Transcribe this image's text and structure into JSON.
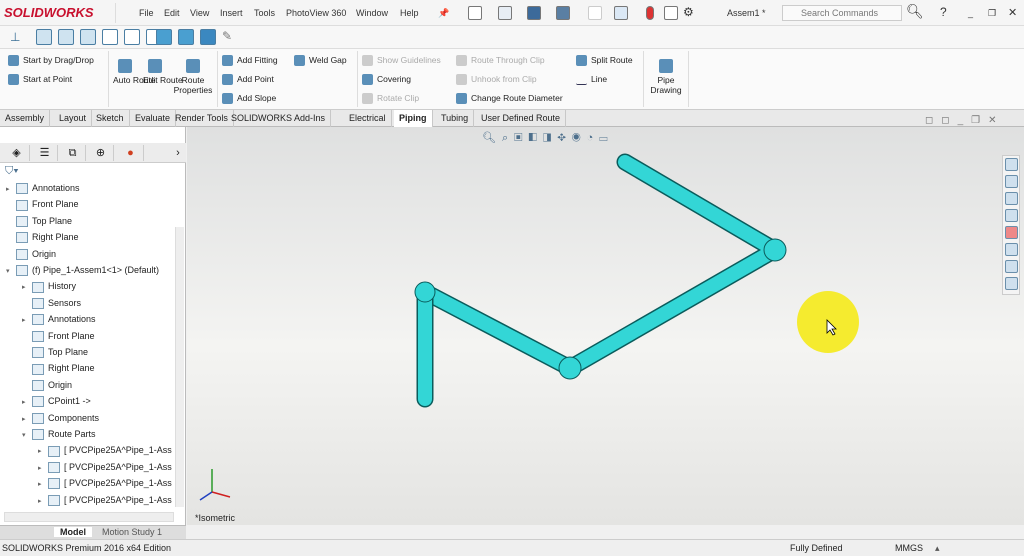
{
  "app": {
    "brand": "SOLIDWORKS",
    "document_title": "Assem1 *",
    "search_placeholder": "Search Commands"
  },
  "menu": [
    "File",
    "Edit",
    "View",
    "Insert",
    "Tools",
    "PhotoView 360",
    "Window",
    "Help"
  ],
  "ribbon": {
    "start_drag_drop": "Start by Drag/Drop",
    "start_at_point": "Start at Point",
    "auto_route": "Auto Route",
    "edit_route": "Edit Route",
    "route_properties": "Route Properties",
    "add_fitting": "Add Fitting",
    "add_point": "Add Point",
    "add_slope": "Add Slope",
    "weld_gap": "Weld Gap",
    "show_guidelines": "Show Guidelines",
    "covering": "Covering",
    "rotate_clip": "Rotate Clip",
    "route_through_clip": "Route Through Clip",
    "unhook_from_clip": "Unhook from Clip",
    "change_route_diameter": "Change Route Diameter",
    "split_route": "Split Route",
    "line": "Line",
    "pipe_drawing": "Pipe Drawing"
  },
  "tabs": [
    {
      "label": "Assembly"
    },
    {
      "label": "Layout"
    },
    {
      "label": "Sketch"
    },
    {
      "label": "Evaluate"
    },
    {
      "label": "Render Tools"
    },
    {
      "label": "SOLIDWORKS Add-Ins"
    },
    {
      "label": "Electrical"
    },
    {
      "label": "Piping",
      "active": true
    },
    {
      "label": "Tubing"
    },
    {
      "label": "User Defined Route"
    }
  ],
  "tree": [
    {
      "label": "Annotations",
      "level": 0,
      "arrow": "▸"
    },
    {
      "label": "Front Plane",
      "level": 0,
      "arrow": ""
    },
    {
      "label": "Top Plane",
      "level": 0,
      "arrow": ""
    },
    {
      "label": "Right Plane",
      "level": 0,
      "arrow": ""
    },
    {
      "label": "Origin",
      "level": 0,
      "arrow": ""
    },
    {
      "label": "(f) Pipe_1-Assem1<1> (Default)",
      "level": 0,
      "arrow": "▾"
    },
    {
      "label": "History",
      "level": 1,
      "arrow": "▸"
    },
    {
      "label": "Sensors",
      "level": 1,
      "arrow": ""
    },
    {
      "label": "Annotations",
      "level": 1,
      "arrow": "▸"
    },
    {
      "label": "Front Plane",
      "level": 1,
      "arrow": ""
    },
    {
      "label": "Top Plane",
      "level": 1,
      "arrow": ""
    },
    {
      "label": "Right Plane",
      "level": 1,
      "arrow": ""
    },
    {
      "label": "Origin",
      "level": 1,
      "arrow": ""
    },
    {
      "label": "CPoint1 ->",
      "level": 1,
      "arrow": "▸"
    },
    {
      "label": "Components",
      "level": 1,
      "arrow": "▸"
    },
    {
      "label": "Route Parts",
      "level": 1,
      "arrow": "▾"
    },
    {
      "label": "[ PVCPipe25A^Pipe_1-Ass",
      "level": 2,
      "arrow": "▸"
    },
    {
      "label": "[ PVCPipe25A^Pipe_1-Ass",
      "level": 2,
      "arrow": "▸"
    },
    {
      "label": "[ PVCPipe25A^Pipe_1-Ass",
      "level": 2,
      "arrow": "▸"
    },
    {
      "label": "[ PVCPipe25A^Pipe_1-Ass",
      "level": 2,
      "arrow": "▸"
    }
  ],
  "bottom_tabs": {
    "model": "Model",
    "motion": "Motion Study 1"
  },
  "viewport": {
    "view_label": "*Isometric",
    "pipe_color": "#33d6d6"
  },
  "status": {
    "edition": "SOLIDWORKS Premium 2016 x64 Edition",
    "state": "Fully Defined",
    "units": "MMGS"
  }
}
